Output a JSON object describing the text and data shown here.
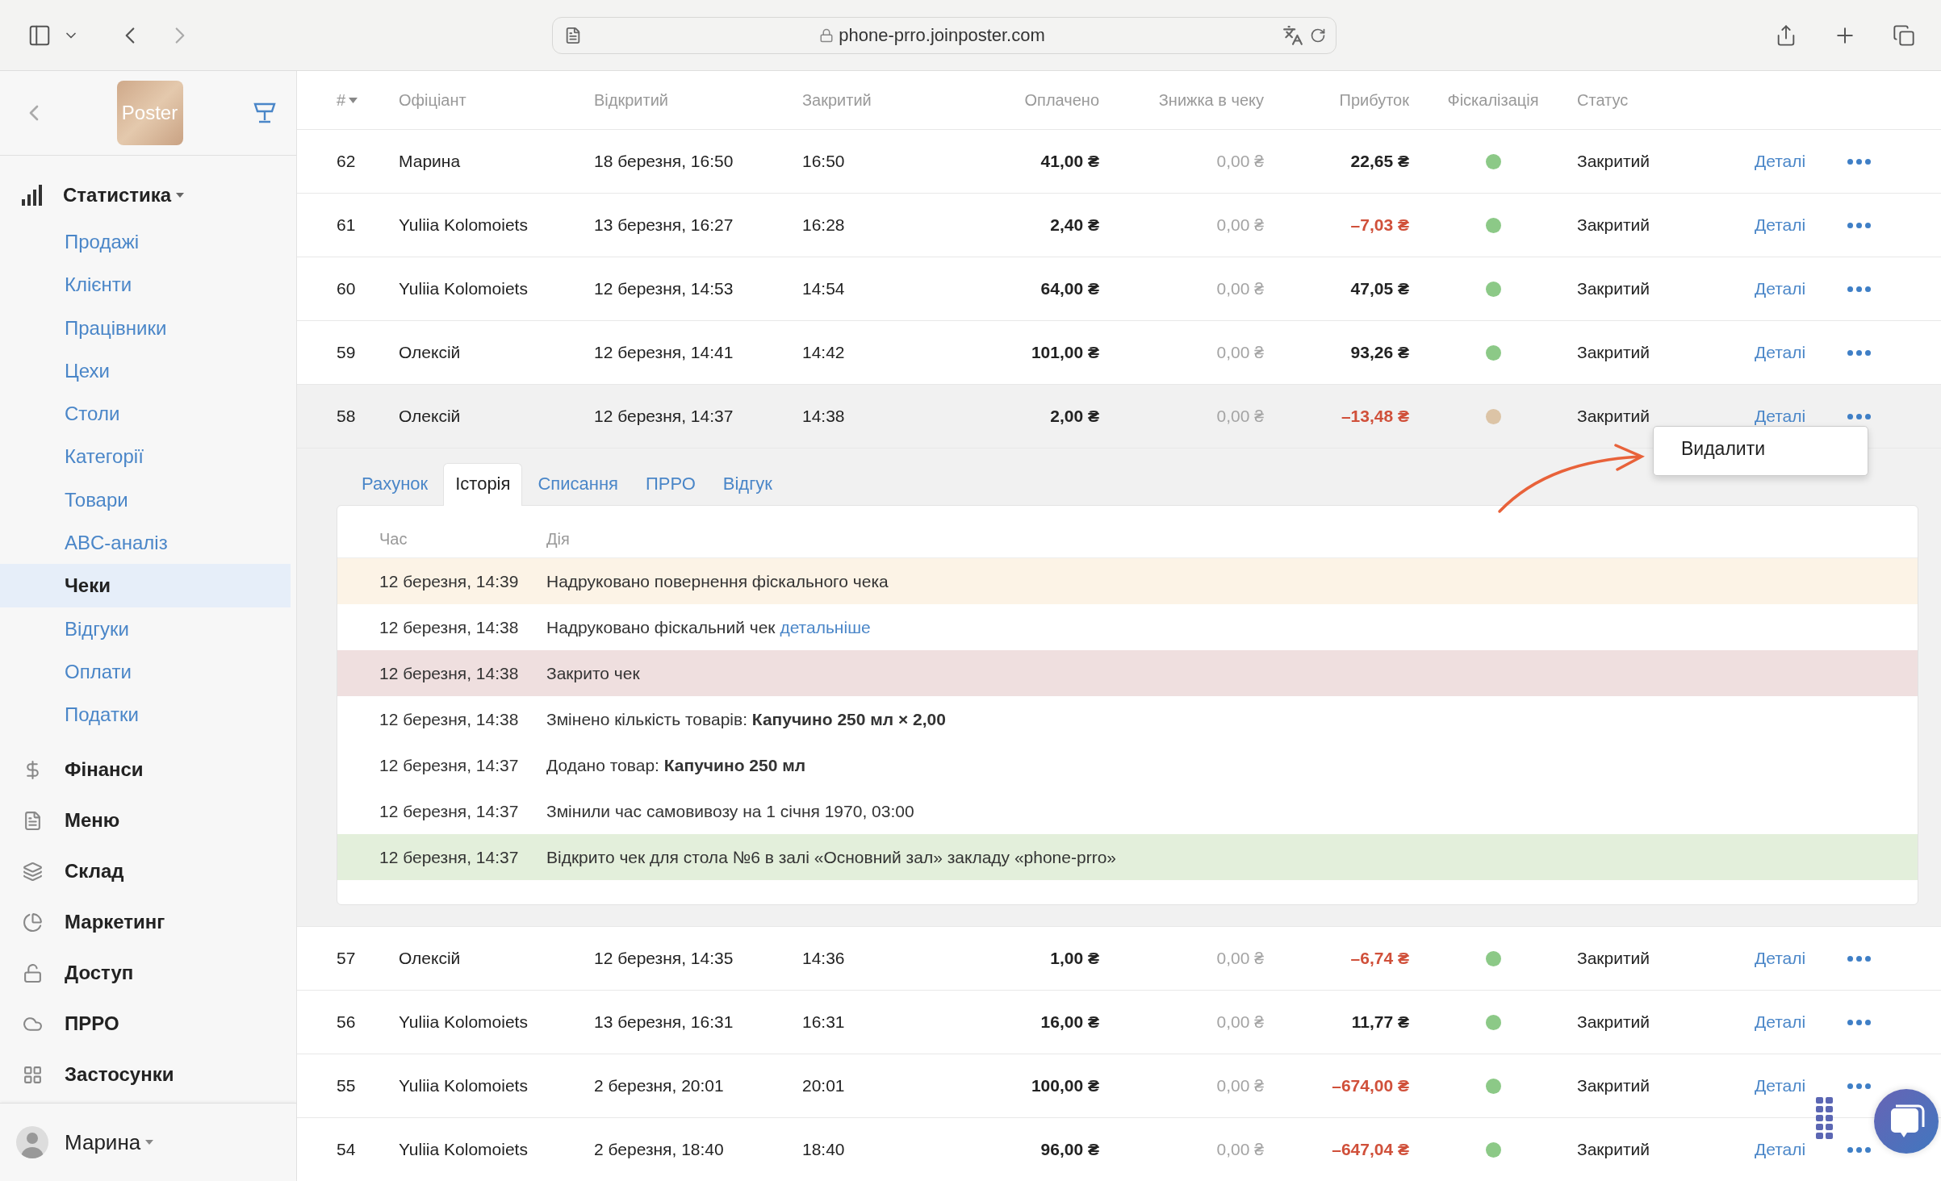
{
  "browser": {
    "url": "phone-prro.joinposter.com"
  },
  "sidebar": {
    "logo": "Poster",
    "sections": [
      {
        "label": "Статистика",
        "expanded": true,
        "items": [
          {
            "label": "Продажі",
            "selected": false
          },
          {
            "label": "Клієнти",
            "selected": false
          },
          {
            "label": "Працівники",
            "selected": false
          },
          {
            "label": "Цехи",
            "selected": false
          },
          {
            "label": "Столи",
            "selected": false
          },
          {
            "label": "Категорії",
            "selected": false
          },
          {
            "label": "Товари",
            "selected": false
          },
          {
            "label": "ABC-аналіз",
            "selected": false
          },
          {
            "label": "Чеки",
            "selected": true
          },
          {
            "label": "Відгуки",
            "selected": false
          },
          {
            "label": "Оплати",
            "selected": false
          },
          {
            "label": "Податки",
            "selected": false
          }
        ]
      },
      {
        "label": "Фінанси"
      },
      {
        "label": "Меню"
      },
      {
        "label": "Склад"
      },
      {
        "label": "Маркетинг"
      },
      {
        "label": "Доступ"
      },
      {
        "label": "ПРРО"
      },
      {
        "label": "Застосунки"
      }
    ],
    "user": {
      "name": "Марина"
    }
  },
  "table": {
    "columns": [
      "#",
      "Офіціант",
      "Відкритий",
      "Закритий",
      "Оплачено",
      "Знижка в чеку",
      "Прибуток",
      "Фіскалізація",
      "Статус"
    ],
    "rows": [
      {
        "number": "62",
        "waiter": "Марина",
        "opened": "18 березня, 16:50",
        "closed": "16:50",
        "paid": "41,00 ₴",
        "discount": "0,00 ₴",
        "profit": "22,65 ₴",
        "loss": false,
        "color": "#8cc987",
        "status": "Закритий",
        "link": "Деталі",
        "expanded": false
      },
      {
        "number": "61",
        "waiter": "Yuliia Kolomoiets",
        "opened": "13 березня, 16:27",
        "closed": "16:28",
        "paid": "2,40 ₴",
        "discount": "0,00 ₴",
        "profit": "–7,03 ₴",
        "loss": true,
        "color": "#8cc987",
        "status": "Закритий",
        "link": "Деталі",
        "expanded": false
      },
      {
        "number": "60",
        "waiter": "Yuliia Kolomoiets",
        "opened": "12 березня, 14:53",
        "closed": "14:54",
        "paid": "64,00 ₴",
        "discount": "0,00 ₴",
        "profit": "47,05 ₴",
        "loss": false,
        "color": "#8cc987",
        "status": "Закритий",
        "link": "Деталі",
        "expanded": false
      },
      {
        "number": "59",
        "waiter": "Олексій",
        "opened": "12 березня, 14:41",
        "closed": "14:42",
        "paid": "101,00 ₴",
        "discount": "0,00 ₴",
        "profit": "93,26 ₴",
        "loss": false,
        "color": "#8cc987",
        "status": "Закритий",
        "link": "Деталі",
        "expanded": false
      },
      {
        "number": "58",
        "waiter": "Олексій",
        "opened": "12 березня, 14:37",
        "closed": "14:38",
        "paid": "2,00 ₴",
        "discount": "0,00 ₴",
        "profit": "–13,48 ₴",
        "loss": true,
        "color": "#dcc4a6",
        "status": "Закритий",
        "link": "Деталі",
        "expanded": true,
        "detail": {
          "tabs": [
            {
              "label": "Рахунок",
              "selected": false
            },
            {
              "label": "Історія",
              "selected": true
            },
            {
              "label": "Списання",
              "selected": false
            },
            {
              "label": "ПРРО",
              "selected": false
            },
            {
              "label": "Відгук",
              "selected": false
            }
          ],
          "columns": [
            "Час",
            "Дія"
          ],
          "history": [
            {
              "time": "12 березня, 14:39",
              "action": "Надруковано повернення фіскального чека",
              "kind": "refund"
            },
            {
              "time": "12 березня, 14:38",
              "action": "Надруковано фіскальний чек",
              "link": "детальніше",
              "kind": "plain"
            },
            {
              "time": "12 березня, 14:38",
              "action": "Закрито чек",
              "kind": "closed"
            },
            {
              "time": "12 березня, 14:38",
              "action": "Змінено кількість товарів: **Капучино 250 мл × 2,00**",
              "kind": "plain"
            },
            {
              "time": "12 березня, 14:37",
              "action": "Додано товар: **Капучино 250 мл**",
              "kind": "plain"
            },
            {
              "time": "12 березня, 14:37",
              "action": "Змінили час самовивозу на 1 січня 1970, 03:00",
              "kind": "plain"
            },
            {
              "time": "12 березня, 14:37",
              "action": "Відкрито чек для стола №6 в залі «Основний зал» закладу «phone-prro»",
              "kind": "opened"
            }
          ]
        }
      },
      {
        "number": "57",
        "waiter": "Олексій",
        "opened": "12 березня, 14:35",
        "closed": "14:36",
        "paid": "1,00 ₴",
        "discount": "0,00 ₴",
        "profit": "–6,74 ₴",
        "loss": true,
        "color": "#8cc987",
        "status": "Закритий",
        "link": "Деталі",
        "expanded": false
      },
      {
        "number": "56",
        "waiter": "Yuliia Kolomoiets",
        "opened": "13 березня, 16:31",
        "closed": "16:31",
        "paid": "16,00 ₴",
        "discount": "0,00 ₴",
        "profit": "11,77 ₴",
        "loss": false,
        "color": "#8cc987",
        "status": "Закритий",
        "link": "Деталі",
        "expanded": false
      },
      {
        "number": "55",
        "waiter": "Yuliia Kolomoiets",
        "opened": "2 березня, 20:01",
        "closed": "20:01",
        "paid": "100,00 ₴",
        "discount": "0,00 ₴",
        "profit": "–674,00 ₴",
        "loss": true,
        "color": "#8cc987",
        "status": "Закритий",
        "link": "Деталі",
        "expanded": false
      },
      {
        "number": "54",
        "waiter": "Yuliia Kolomoiets",
        "opened": "2 березня, 18:40",
        "closed": "18:40",
        "paid": "96,00 ₴",
        "discount": "0,00 ₴",
        "profit": "–647,04 ₴",
        "loss": true,
        "color": "#8cc987",
        "status": "Закритий",
        "link": "Деталі",
        "expanded": false
      }
    ]
  },
  "context_menu": {
    "items": [
      "Видалити"
    ]
  }
}
